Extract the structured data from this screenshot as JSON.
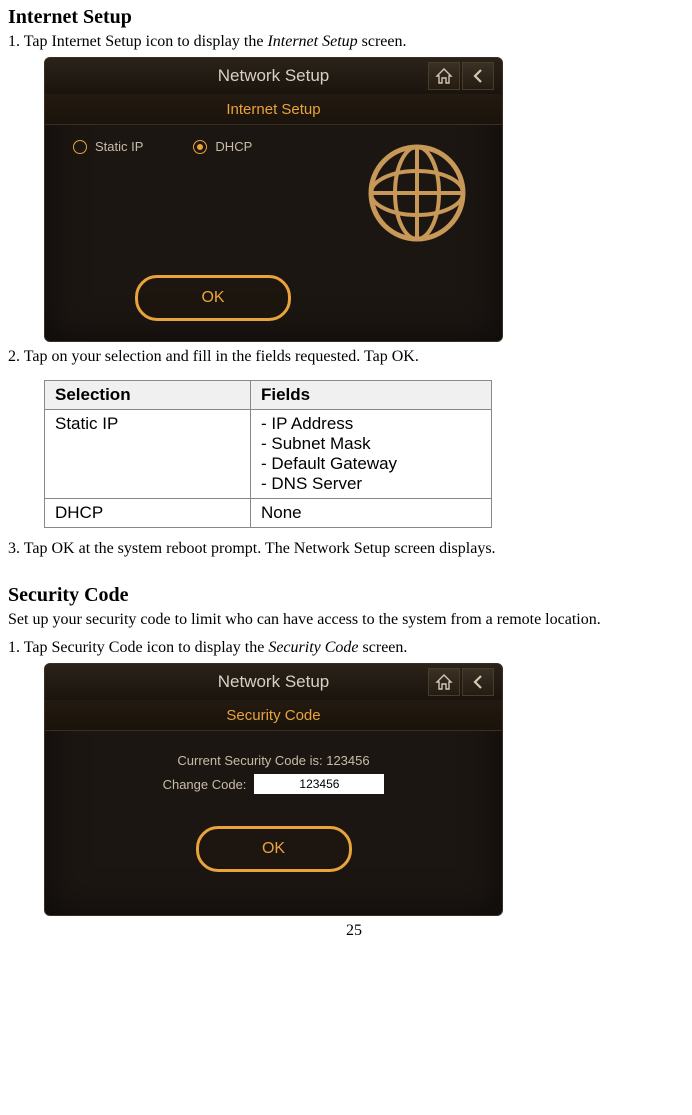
{
  "section1": {
    "heading": "Internet Setup",
    "steps": [
      {
        "n": "1.",
        "pre": "Tap Internet Setup icon to display the ",
        "em": "Internet Setup",
        "post": " screen."
      },
      {
        "n": "2.",
        "text": "Tap on your selection and fill in the fields requested. Tap OK."
      },
      {
        "n": "3.",
        "text": "Tap OK at the system reboot prompt. The Network Setup screen displays."
      }
    ],
    "screenshot": {
      "title": "Network Setup",
      "subtitle": "Internet Setup",
      "radios": [
        {
          "label": "Static IP",
          "checked": false
        },
        {
          "label": "DHCP",
          "checked": true
        }
      ],
      "ok": "OK"
    },
    "table": {
      "headers": [
        "Selection",
        "Fields"
      ],
      "rows": [
        {
          "c0": "Static IP",
          "c1": "- IP Address\n- Subnet Mask\n- Default Gateway\n- DNS Server"
        },
        {
          "c0": "DHCP",
          "c1": "None"
        }
      ]
    }
  },
  "section2": {
    "heading": "Security Code",
    "intro": "Set up your security code to limit who can have access to the system from a remote location.",
    "steps": [
      {
        "n": "1.",
        "pre": "Tap Security Code icon to display the ",
        "em": "Security Code",
        "post": " screen."
      }
    ],
    "screenshot": {
      "title": "Network Setup",
      "subtitle": "Security Code",
      "current_label": "Current Security Code is: 123456",
      "change_label": "Change Code:",
      "code_value": "123456",
      "ok": "OK"
    }
  },
  "page": "25"
}
